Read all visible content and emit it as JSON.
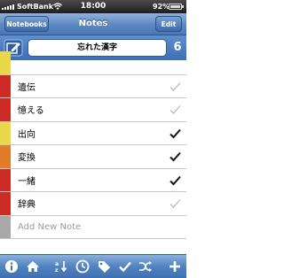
{
  "status_bar": {
    "carrier": "SoftBank",
    "time": "18:00",
    "battery": "92%"
  },
  "nav": {
    "back_label": "Notebooks",
    "title": "Notes",
    "edit_label": "Edit"
  },
  "title_row": {
    "title": "忘れた漢字",
    "count": "6"
  },
  "notes": [
    {
      "label": "",
      "color": "#e8d84a",
      "checked": "none"
    },
    {
      "label": "遺伝",
      "color": "#cc2c25",
      "checked": "light"
    },
    {
      "label": "憶える",
      "color": "#cc2c25",
      "checked": "light"
    },
    {
      "label": "出向",
      "color": "#e8d84a",
      "checked": "dark"
    },
    {
      "label": "変換",
      "color": "#e07d2a",
      "checked": "dark"
    },
    {
      "label": "一緒",
      "color": "#cc2c25",
      "checked": "dark"
    },
    {
      "label": "辞典",
      "color": "#cc2c25",
      "checked": "light"
    },
    {
      "label": "Add New Note",
      "color": "#a8a8a8",
      "checked": "none",
      "placeholder": true
    }
  ],
  "toolbar": {
    "icons": [
      "info-icon",
      "home-icon",
      "sort-icon",
      "clock-icon",
      "tag-icon",
      "check-icon",
      "shuffle-icon",
      "add-icon"
    ]
  }
}
